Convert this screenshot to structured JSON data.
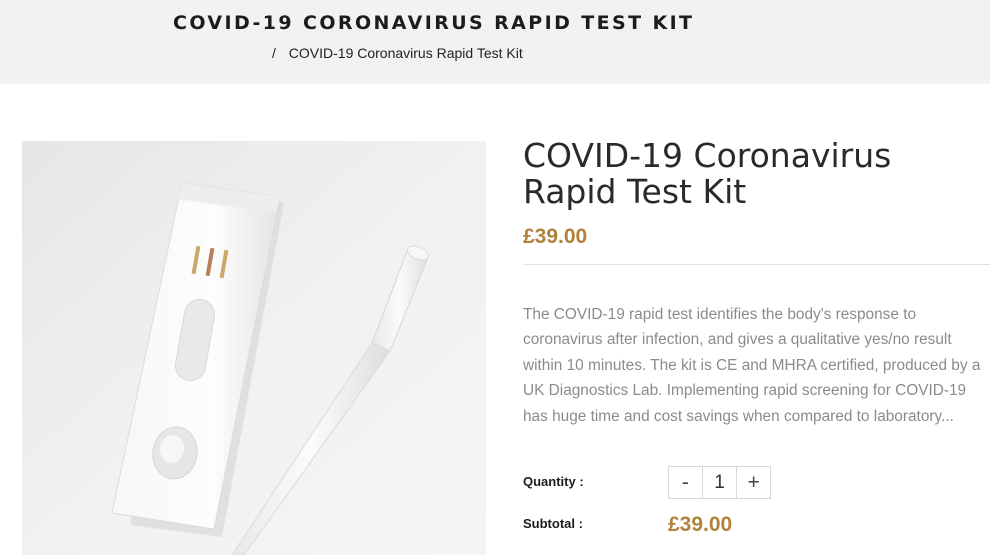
{
  "header": {
    "title": "COVID-19 CORONAVIRUS RAPID TEST KIT",
    "breadcrumb": {
      "separator": "/",
      "current": "COVID-19 Coronavirus Rapid Test Kit"
    }
  },
  "product": {
    "title": "COVID-19 Coronavirus Rapid Test Kit",
    "price": "£39.00",
    "description": "The COVID-19 rapid test identifies the body's response to coronavirus after infection, and gives a qualitative yes/no result within 10 minutes. The kit is CE and MHRA certified, produced by a UK Diagnostics Lab. Implementing rapid screening for COVID-19 has huge time and cost savings when compared to laboratory...",
    "quantity_label": "Quantity :",
    "quantity_value": "1",
    "decrement_label": "-",
    "increment_label": "+",
    "subtotal_label": "Subtotal :",
    "subtotal_value": "£39.00"
  },
  "colors": {
    "accent_price": "#b0823a",
    "banner_bg": "#f2f2f2"
  }
}
